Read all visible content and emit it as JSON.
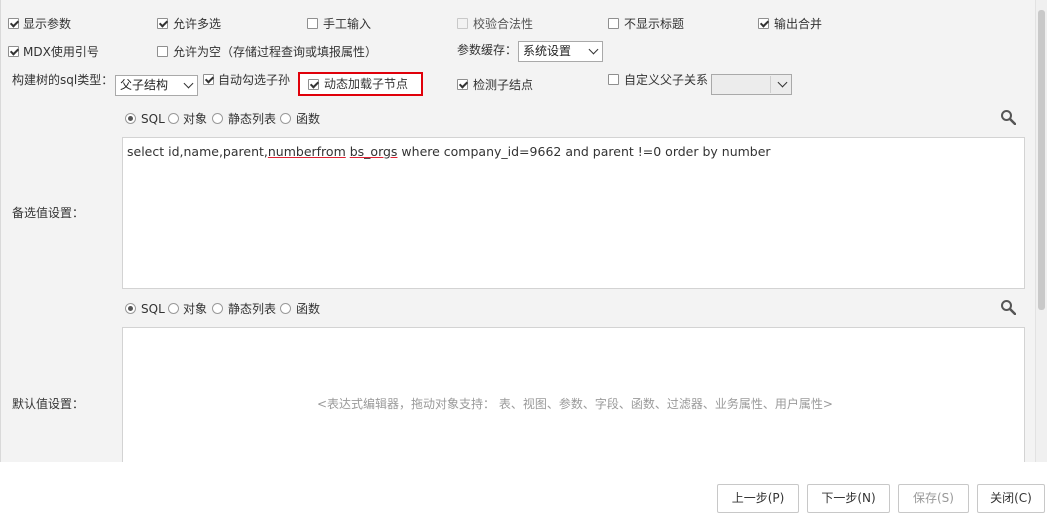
{
  "options_row1": {
    "show_params": "显示参数",
    "allow_multi": "允许多选",
    "manual_input": "手工输入",
    "validate": "校验合法性",
    "hide_title": "不显示标题",
    "output_merge": "输出合并"
  },
  "options_row2": {
    "mdx_quote": "MDX使用引号",
    "allow_empty": "允许为空（存储过程查询或填报属性）",
    "param_cache_label": "参数缓存：",
    "param_cache_value": "系统设置"
  },
  "options_row3": {
    "tree_sql_label": "构建树的sql类型：",
    "tree_type_value": "父子结构",
    "auto_check_children": "自动勾选子孙",
    "dynamic_load_children": "动态加载子节点",
    "detect_children": "检测子结点",
    "custom_parent_child": "自定义父子关系"
  },
  "candidate": {
    "label": "备选值设置：",
    "modes": [
      "SQL",
      "对象",
      "静态列表",
      "函数"
    ],
    "sql_parts": {
      "a": "select id,name,parent,",
      "b": "numberfrom",
      "c": " ",
      "d": "bs_orgs",
      "e": " where company_id=9662 and parent !=0 order by number"
    }
  },
  "default": {
    "label": "默认值设置：",
    "modes": [
      "SQL",
      "对象",
      "静态列表",
      "函数"
    ],
    "placeholder": "<表达式编辑器，拖动对象支持： 表、视图、参数、字段、函数、过滤器、业务属性、用户属性>"
  },
  "footer": {
    "prev": "上一步(P)",
    "next": "下一步(N)",
    "save": "保存(S)",
    "close": "关闭(C)"
  }
}
